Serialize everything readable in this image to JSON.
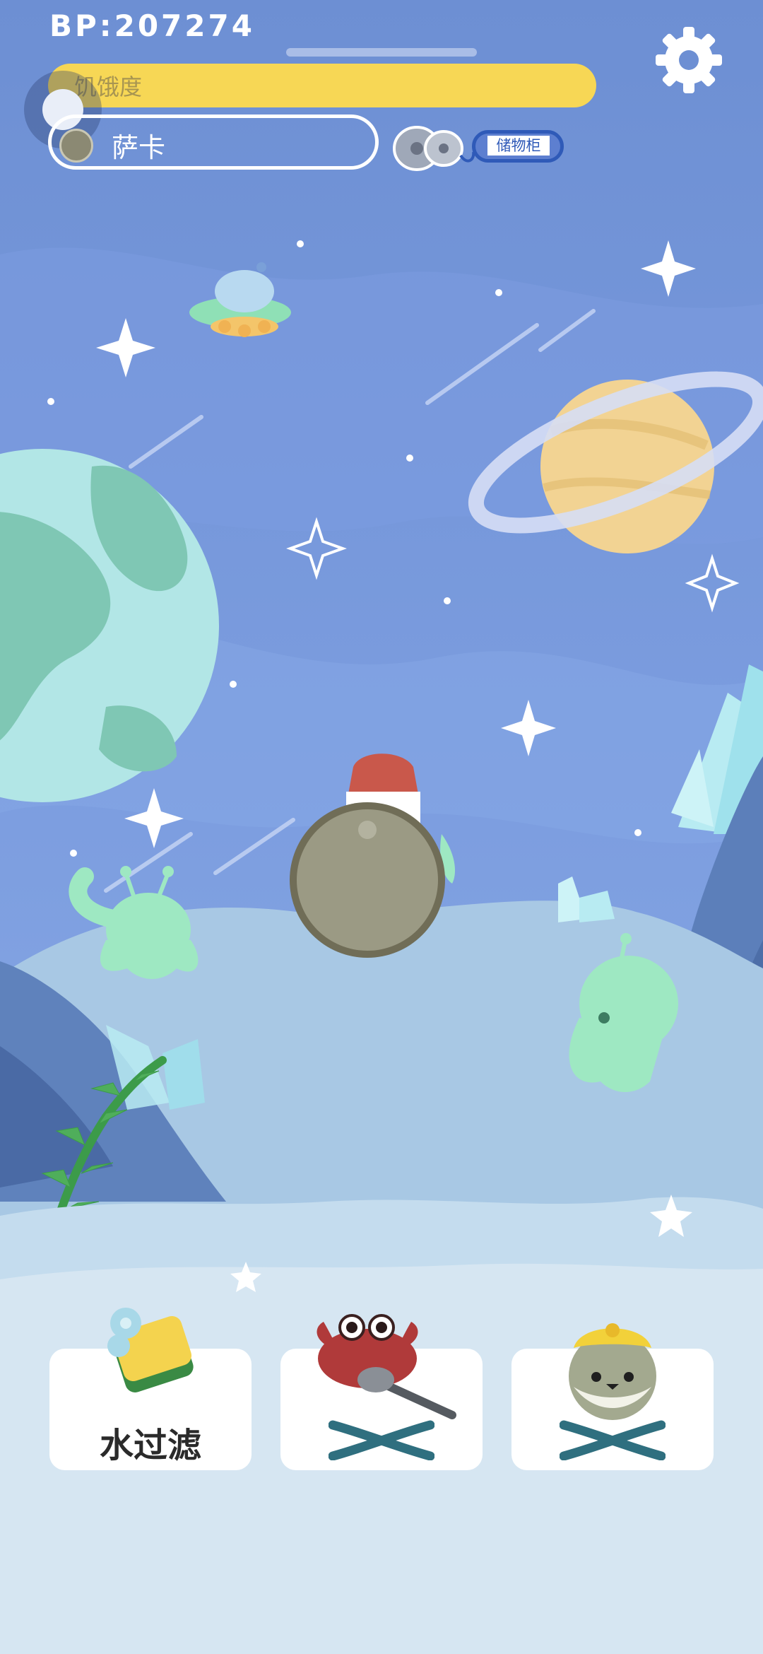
{
  "hud": {
    "bp": "BP:207274",
    "hunger_label": "饥饿度",
    "hunger_level": 1.0,
    "pet_name": "萨卡",
    "storage_label": "储物柜"
  },
  "buttons": {
    "filter_label": "水过滤",
    "crab_status": "locked",
    "fish_status": "locked"
  },
  "colors": {
    "sky": "#6f91d4",
    "hunger_bar": "#f7d755",
    "storage_border": "#2f5ab8",
    "lock_x": "#2f6f7f",
    "ground": "#d6e6f2"
  },
  "icons": {
    "settings": "gear-icon",
    "storage": "storage-icon",
    "filter": "sponge-icon",
    "crab": "crab-icon",
    "fish": "fish-icon",
    "locked": "x-mark-icon"
  }
}
